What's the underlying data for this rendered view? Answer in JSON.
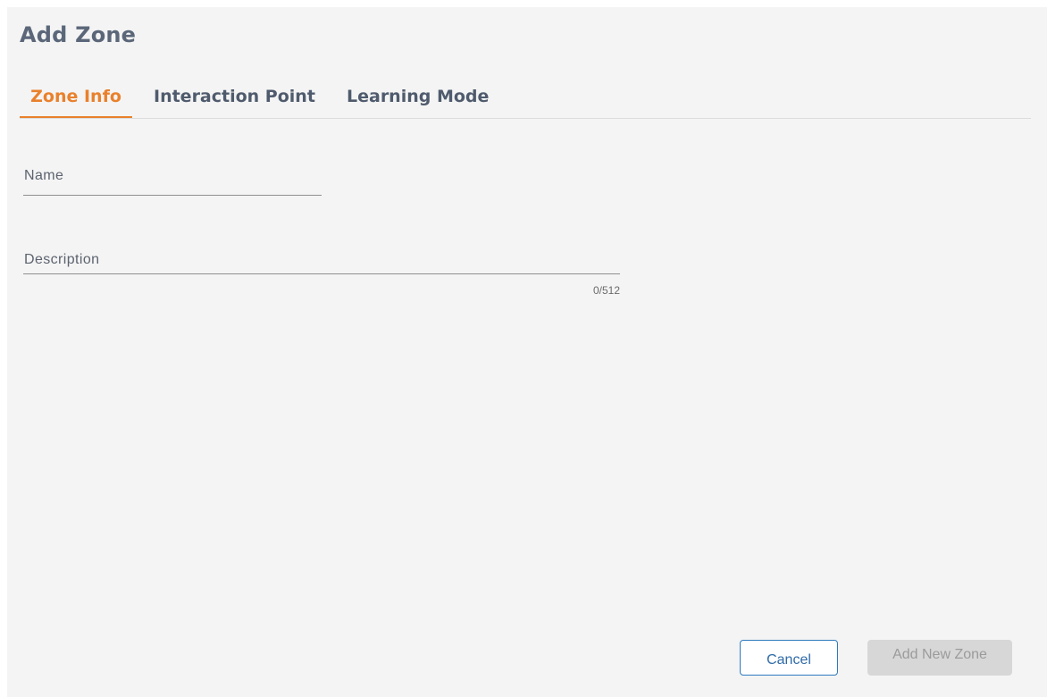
{
  "dialog": {
    "title": "Add Zone"
  },
  "tabs": [
    {
      "label": "Zone Info",
      "active": true
    },
    {
      "label": "Interaction Point",
      "active": false
    },
    {
      "label": "Learning Mode",
      "active": false
    }
  ],
  "form": {
    "name": {
      "label": "Name",
      "value": ""
    },
    "description": {
      "label": "Description",
      "value": "",
      "counter": "0/512"
    }
  },
  "actions": {
    "cancel_label": "Cancel",
    "add_label": "Add New Zone"
  },
  "colors": {
    "accent": "#e9812c",
    "primary": "#2e79bd",
    "background": "#f4f4f4",
    "disabled": "#d7d7d7"
  }
}
